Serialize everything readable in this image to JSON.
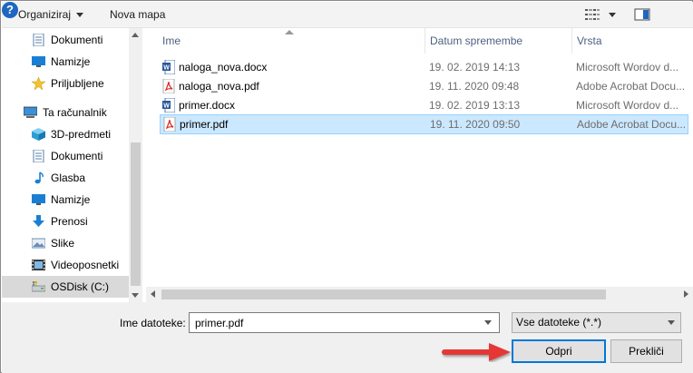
{
  "toolbar": {
    "organize_label": "Organiziraj",
    "new_folder_label": "Nova mapa"
  },
  "nav": {
    "items": [
      {
        "label": "Dokumenti",
        "icon": "document-icon"
      },
      {
        "label": "Namizje",
        "icon": "desktop-icon"
      },
      {
        "label": "Priljubljene",
        "icon": "star-icon"
      },
      {
        "label": "Ta računalnik",
        "icon": "computer-icon"
      },
      {
        "label": "3D-predmeti",
        "icon": "cube-icon"
      },
      {
        "label": "Dokumenti",
        "icon": "document-icon"
      },
      {
        "label": "Glasba",
        "icon": "music-icon"
      },
      {
        "label": "Namizje",
        "icon": "desktop-icon"
      },
      {
        "label": "Prenosi",
        "icon": "download-icon"
      },
      {
        "label": "Slike",
        "icon": "pictures-icon"
      },
      {
        "label": "Videoposnetki",
        "icon": "video-icon"
      },
      {
        "label": "OSDisk (C:)",
        "icon": "drive-icon"
      }
    ]
  },
  "list": {
    "columns": [
      "Ime",
      "Datum spremembe",
      "Vrsta"
    ],
    "rows": [
      {
        "name": "naloga_nova.docx",
        "date": "19. 02. 2019 14:13",
        "type": "Microsoft Wordov d...",
        "icon": "word-icon"
      },
      {
        "name": "naloga_nova.pdf",
        "date": "19. 11. 2020 09:48",
        "type": "Adobe Acrobat Docu...",
        "icon": "pdf-icon"
      },
      {
        "name": "primer.docx",
        "date": "19. 02. 2019 13:13",
        "type": "Microsoft Wordov d...",
        "icon": "word-icon"
      },
      {
        "name": "primer.pdf",
        "date": "19. 11. 2020 09:50",
        "type": "Adobe Acrobat Docu...",
        "icon": "pdf-icon"
      }
    ]
  },
  "bottom": {
    "filename_label": "Ime datoteke:",
    "filename_value": "primer.pdf",
    "filter_value": "Vse datoteke (*.*)",
    "open_label": "Odpri",
    "cancel_label": "Prekliči"
  },
  "colors": {
    "accent": "#0078d7",
    "selection": "#cce8ff",
    "callout": "#e53935"
  }
}
